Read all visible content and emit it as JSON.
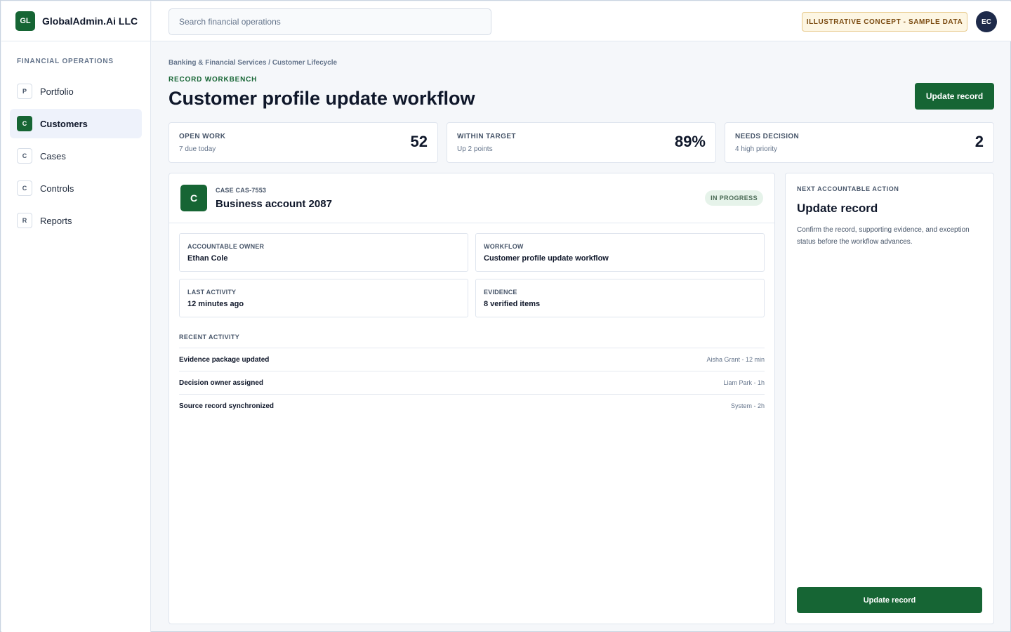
{
  "brand": {
    "logo": "GL",
    "name": "GlobalAdmin.Ai LLC"
  },
  "search": {
    "placeholder": "Search financial operations"
  },
  "header": {
    "concept_badge": "ILLUSTRATIVE CONCEPT - SAMPLE DATA",
    "avatar_initials": "EC"
  },
  "sidebar": {
    "section": "FINANCIAL OPERATIONS",
    "items": [
      {
        "badge": "P",
        "label": "Portfolio",
        "active": false
      },
      {
        "badge": "C",
        "label": "Customers",
        "active": true
      },
      {
        "badge": "C",
        "label": "Cases",
        "active": false
      },
      {
        "badge": "C",
        "label": "Controls",
        "active": false
      },
      {
        "badge": "R",
        "label": "Reports",
        "active": false
      }
    ]
  },
  "page": {
    "breadcrumb": "Banking & Financial Services / Customer Lifecycle",
    "eyebrow": "RECORD WORKBENCH",
    "title": "Customer profile update workflow",
    "primary_action": "Update record"
  },
  "kpis": [
    {
      "label": "OPEN WORK",
      "sub": "7 due today",
      "value": "52"
    },
    {
      "label": "WITHIN TARGET",
      "sub": "Up 2 points",
      "value": "89%"
    },
    {
      "label": "NEEDS DECISION",
      "sub": "4 high priority",
      "value": "2"
    }
  ],
  "case": {
    "icon": "C",
    "id": "CASE CAS-7553",
    "name": "Business account 2087",
    "status": "IN PROGRESS",
    "fields": [
      {
        "label": "ACCOUNTABLE OWNER",
        "value": "Ethan Cole"
      },
      {
        "label": "WORKFLOW",
        "value": "Customer profile update workflow"
      },
      {
        "label": "LAST ACTIVITY",
        "value": "12 minutes ago"
      },
      {
        "label": "EVIDENCE",
        "value": "8 verified items"
      }
    ],
    "activity_title": "RECENT ACTIVITY",
    "activity": [
      {
        "title": "Evidence package updated",
        "meta": "Aisha Grant - 12 min"
      },
      {
        "title": "Decision owner assigned",
        "meta": "Liam Park - 1h"
      },
      {
        "title": "Source record synchronized",
        "meta": "System - 2h"
      }
    ]
  },
  "action_panel": {
    "eyebrow": "NEXT ACCOUNTABLE ACTION",
    "title": "Update record",
    "description": "Confirm the record, supporting evidence, and exception status before the workflow advances.",
    "button": "Update record"
  },
  "colors": {
    "accent": "#166534",
    "avatar": "#1e2a4a",
    "concept_badge_bg": "#fdf6e3"
  }
}
